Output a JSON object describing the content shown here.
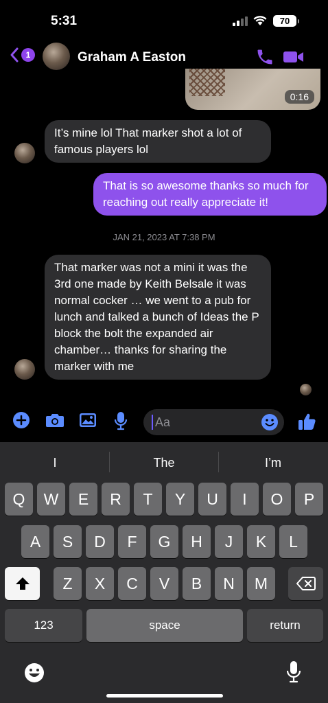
{
  "status_bar": {
    "time": "5:31",
    "battery": "70"
  },
  "header": {
    "unread_count": "1",
    "contact_name": "Graham A Easton"
  },
  "video": {
    "duration": "0:16"
  },
  "messages": [
    {
      "direction": "incoming",
      "text": "It’s mine lol That marker shot a lot of famous players lol"
    },
    {
      "direction": "outgoing",
      "text": "That is so awesome thanks so much for reaching out really appreciate it!"
    },
    {
      "direction": "incoming",
      "text": "That marker was not a mini it was the 3rd one made by Keith Belsale it was normal cocker … we went to a pub for lunch and talked a bunch of Ideas the P block the bolt the expanded air chamber… thanks for sharing the marker with me"
    }
  ],
  "timestamp": "JAN 21, 2023 AT 7:38 PM",
  "composer": {
    "placeholder": "Aa"
  },
  "keyboard": {
    "suggestions": [
      "I",
      "The",
      "I’m"
    ],
    "row1": [
      "Q",
      "W",
      "E",
      "R",
      "T",
      "Y",
      "U",
      "I",
      "O",
      "P"
    ],
    "row2": [
      "A",
      "S",
      "D",
      "F",
      "G",
      "H",
      "J",
      "K",
      "L"
    ],
    "row3": [
      "Z",
      "X",
      "C",
      "V",
      "B",
      "N",
      "M"
    ],
    "numbers_key": "123",
    "space_key": "space",
    "return_key": "return"
  },
  "colors": {
    "accent": "#8e52ec",
    "bubble_in": "#2e2e30",
    "icon_blue": "#5b8cff"
  },
  "icons": [
    "back-chevron-icon",
    "phone-icon",
    "video-camera-icon",
    "plus-icon",
    "camera-icon",
    "gallery-icon",
    "microphone-icon",
    "emoji-icon",
    "thumbs-up-icon",
    "shift-icon",
    "delete-icon",
    "keyboard-emoji-icon",
    "dictation-icon"
  ]
}
